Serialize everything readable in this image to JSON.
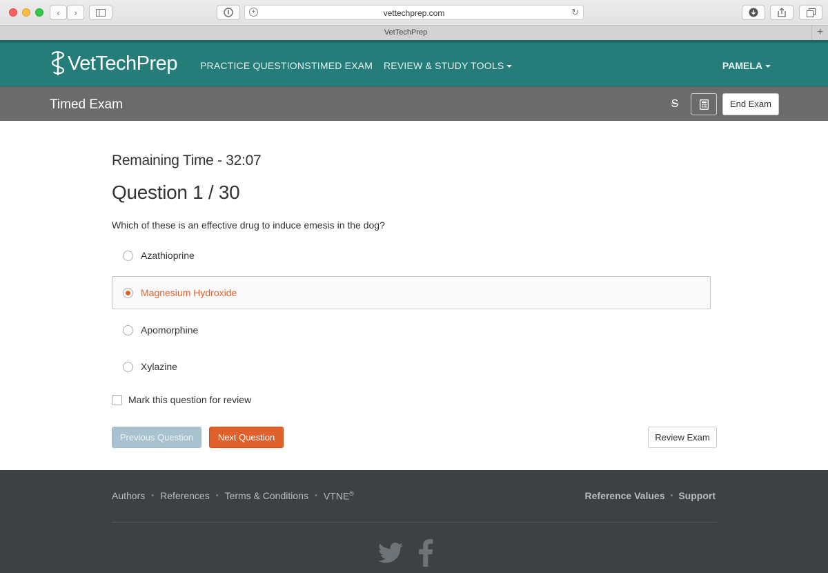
{
  "browser": {
    "url": "vettechprep.com",
    "tab_title": "VetTechPrep"
  },
  "nav": {
    "logo_text": "VetTechPrep",
    "links": [
      {
        "label": "PRACTICE QUESTIONS"
      },
      {
        "label": "TIMED EXAM"
      },
      {
        "label": "REVIEW & STUDY TOOLS"
      }
    ],
    "user": "PAMELA"
  },
  "subheader": {
    "title": "Timed Exam",
    "end_label": "End Exam"
  },
  "exam": {
    "remaining_time": "Remaining Time - 32:07",
    "question_number": "Question 1 / 30",
    "question_text": "Which of these is an effective drug to induce emesis in the dog?",
    "options": [
      {
        "label": "Azathioprine",
        "selected": false
      },
      {
        "label": "Magnesium Hydroxide",
        "selected": true
      },
      {
        "label": "Apomorphine",
        "selected": false
      },
      {
        "label": "Xylazine",
        "selected": false
      }
    ],
    "mark_review_label": "Mark this question for review",
    "mark_review_checked": false,
    "prev_label": "Previous Question",
    "next_label": "Next Question",
    "review_label": "Review Exam"
  },
  "footer": {
    "links": [
      "Authors",
      "References",
      "Terms & Conditions",
      "VTNE"
    ],
    "vtne_mark": "®",
    "right_links": [
      "Reference Values",
      "Support"
    ]
  },
  "colors": {
    "nav_bg": "#257d7a",
    "subbar_bg": "#6b6b6b",
    "accent_orange": "#e0602c",
    "prev_disabled": "#a8c2d0",
    "footer_bg": "#3d4144"
  }
}
